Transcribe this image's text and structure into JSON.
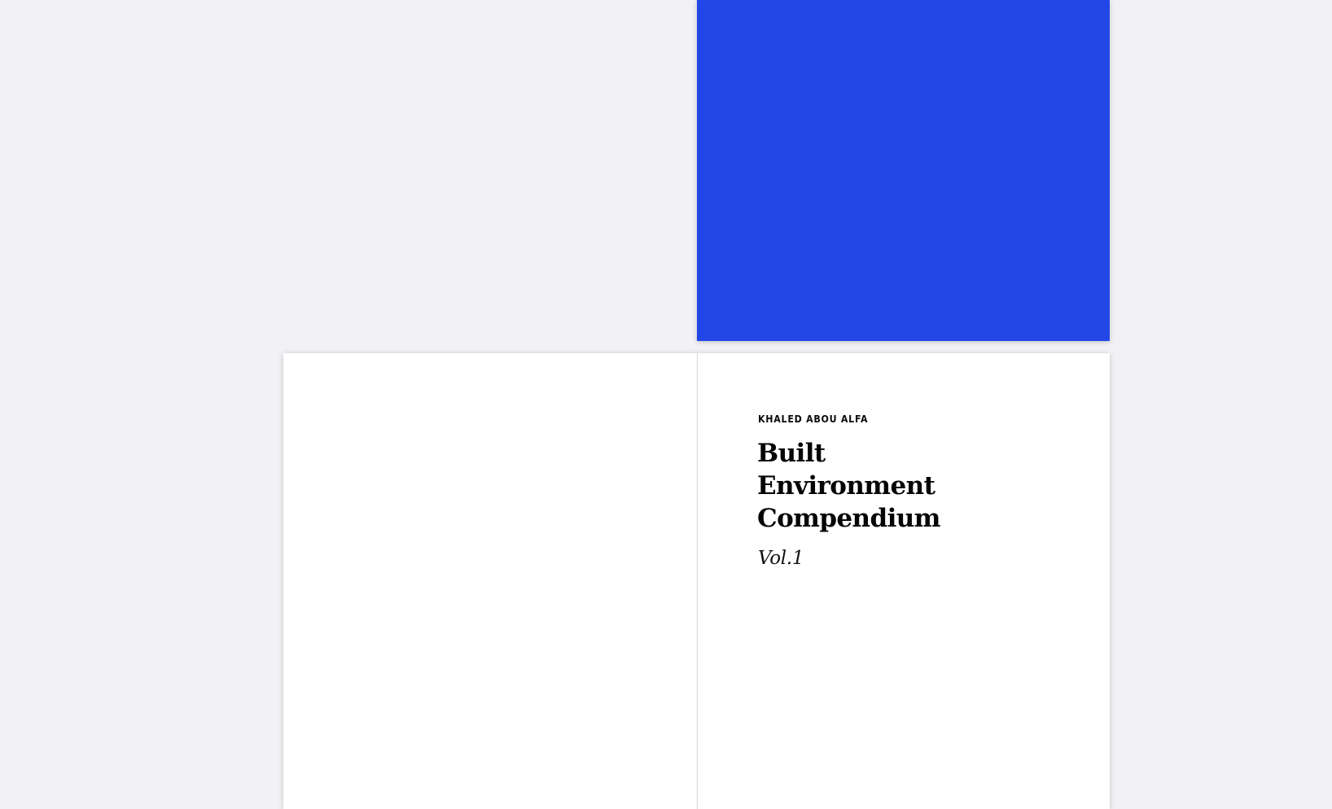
{
  "colors": {
    "background": "#f2f2f6",
    "cover": "#2347e6",
    "page": "#ffffff",
    "text": "#050505"
  },
  "book": {
    "author": "KHALED ABOU ALFA",
    "title_lines": [
      "Built",
      "Environment",
      "Compendium"
    ],
    "volume": "Vol.1"
  }
}
